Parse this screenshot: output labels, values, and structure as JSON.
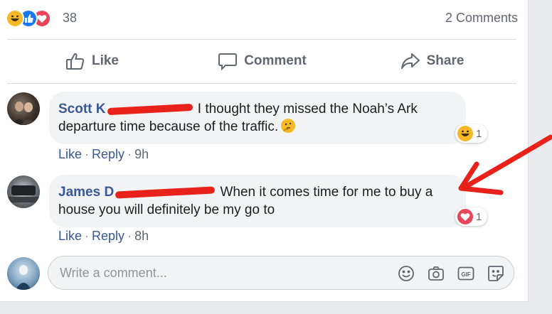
{
  "summary": {
    "reaction_icons": [
      "haha-icon",
      "like-icon",
      "love-icon"
    ],
    "reaction_count": "38",
    "comments_count": "2 Comments"
  },
  "actions": {
    "like": "Like",
    "comment": "Comment",
    "share": "Share"
  },
  "comments": [
    {
      "author": "Scott K",
      "text": "I thought they missed the Noah’s Ark departure time because of the traffic.",
      "reaction_icon": "haha-icon",
      "reaction_count": "1",
      "like": "Like",
      "reply": "Reply",
      "time": "9h"
    },
    {
      "author": "James D",
      "text": "When it comes time for me to buy a house you will definitely be my go to",
      "reaction_icon": "love-icon",
      "reaction_count": "1",
      "like": "Like",
      "reply": "Reply",
      "time": "8h"
    }
  ],
  "composer": {
    "placeholder": "Write a comment..."
  },
  "colors": {
    "link": "#385898",
    "muted": "#606770",
    "bubble": "#f2f3f5",
    "annotation": "#e8221a",
    "like_blue": "#1877f2",
    "love_red": "#e9445a",
    "haha_yellow": "#f7b928"
  }
}
